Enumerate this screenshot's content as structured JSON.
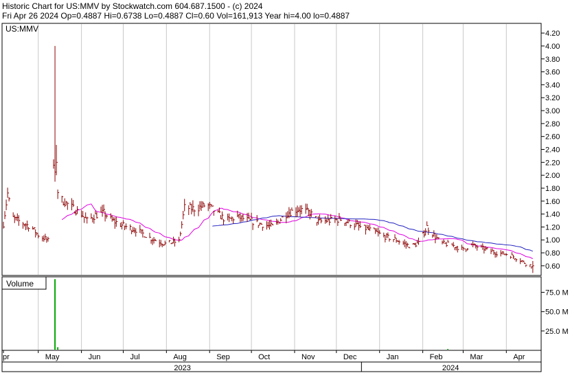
{
  "header": {
    "line1": "Historic Chart for US:MMV by Stockwatch.com 604.687.1500 - (c) 2024",
    "line2": "Fri Apr 26 2024   Op=0.4887   Hi=0.6738   Lo=0.4887   Cl=0.60   Vol=161,913   Year hi=4.00   lo=0.4887"
  },
  "price_panel": {
    "symbol_label": "US:MMV"
  },
  "volume_panel": {
    "label": "Volume"
  },
  "colors": {
    "background": "#ffffff",
    "grid": "#c8c8c8",
    "bars": "#8b0000",
    "ma_short": "#e000e0",
    "ma_long": "#2020c0",
    "volume": "#00aa00",
    "axis": "#000000"
  },
  "chart_data": {
    "type": "ohlc",
    "title": "Historic Chart for US:MMV",
    "ylim": [
      0.45,
      4.35
    ],
    "y_ticks": [
      "4.20",
      "4.00",
      "3.80",
      "3.60",
      "3.40",
      "3.20",
      "3.00",
      "2.80",
      "2.60",
      "2.40",
      "2.20",
      "2.00",
      "1.80",
      "1.60",
      "1.40",
      "1.20",
      "1.00",
      "0.80",
      "0.60"
    ],
    "x_months": [
      {
        "label": "pr",
        "day": 0
      },
      {
        "label": "May",
        "day": 25
      },
      {
        "label": "Jun",
        "day": 56
      },
      {
        "label": "Jul",
        "day": 86
      },
      {
        "label": "Aug",
        "day": 117
      },
      {
        "label": "Sep",
        "day": 148
      },
      {
        "label": "Oct",
        "day": 178
      },
      {
        "label": "Nov",
        "day": 209
      },
      {
        "label": "Dec",
        "day": 239
      },
      {
        "label": "Jan",
        "day": 270
      },
      {
        "label": "Feb",
        "day": 301
      },
      {
        "label": "Mar",
        "day": 330
      },
      {
        "label": "Apr",
        "day": 361
      }
    ],
    "x_years": [
      {
        "label": "2023",
        "from_day": 0,
        "to_day": 257
      },
      {
        "label": "2024",
        "from_day": 257,
        "to_day": 385
      }
    ],
    "price_keyframes": [
      [
        0,
        1.25
      ],
      [
        3,
        1.72
      ],
      [
        6,
        1.35
      ],
      [
        12,
        1.28
      ],
      [
        20,
        1.2
      ],
      [
        26,
        1.05
      ],
      [
        30,
        1.02
      ],
      [
        33,
        0.97
      ],
      [
        36,
        2.2
      ],
      [
        38,
        1.8
      ],
      [
        42,
        1.62
      ],
      [
        48,
        1.52
      ],
      [
        56,
        1.4
      ],
      [
        60,
        1.3
      ],
      [
        66,
        1.38
      ],
      [
        72,
        1.42
      ],
      [
        78,
        1.3
      ],
      [
        86,
        1.22
      ],
      [
        96,
        1.15
      ],
      [
        106,
        1.02
      ],
      [
        116,
        0.94
      ],
      [
        126,
        0.98
      ],
      [
        130,
        1.5
      ],
      [
        138,
        1.48
      ],
      [
        146,
        1.55
      ],
      [
        154,
        1.4
      ],
      [
        160,
        1.3
      ],
      [
        168,
        1.36
      ],
      [
        176,
        1.3
      ],
      [
        184,
        1.25
      ],
      [
        194,
        1.2
      ],
      [
        198,
        1.3
      ],
      [
        204,
        1.42
      ],
      [
        212,
        1.48
      ],
      [
        220,
        1.42
      ],
      [
        226,
        1.28
      ],
      [
        234,
        1.3
      ],
      [
        242,
        1.32
      ],
      [
        250,
        1.25
      ],
      [
        256,
        1.2
      ],
      [
        264,
        1.15
      ],
      [
        274,
        1.05
      ],
      [
        282,
        1.0
      ],
      [
        292,
        0.9
      ],
      [
        298,
        0.95
      ],
      [
        304,
        1.2
      ],
      [
        308,
        1.1
      ],
      [
        314,
        0.95
      ],
      [
        322,
        0.92
      ],
      [
        330,
        0.85
      ],
      [
        336,
        0.92
      ],
      [
        344,
        0.87
      ],
      [
        354,
        0.8
      ],
      [
        362,
        0.78
      ],
      [
        370,
        0.7
      ],
      [
        376,
        0.62
      ],
      [
        380,
        0.6
      ]
    ],
    "gap": [
      34,
      36
    ],
    "spikes": [
      {
        "day": 37,
        "high": 4.0,
        "low": 1.9,
        "close": 2.05
      },
      {
        "day": 38,
        "high": 2.47,
        "low": 2.0,
        "close": 2.2
      }
    ],
    "last_bar": {
      "day": 380,
      "open": 0.4887,
      "high": 0.6738,
      "low": 0.4887,
      "close": 0.6
    },
    "year_high": 4.0,
    "year_low": 0.4887,
    "volume": {
      "ylim": [
        0,
        95
      ],
      "y_ticks": [
        "75.0 M",
        "50.0 M",
        "25.0 M"
      ],
      "bars": [
        {
          "day": 37,
          "value": 92
        },
        {
          "day": 39,
          "value": 4
        },
        {
          "day": 319,
          "value": 0.8
        }
      ]
    }
  }
}
